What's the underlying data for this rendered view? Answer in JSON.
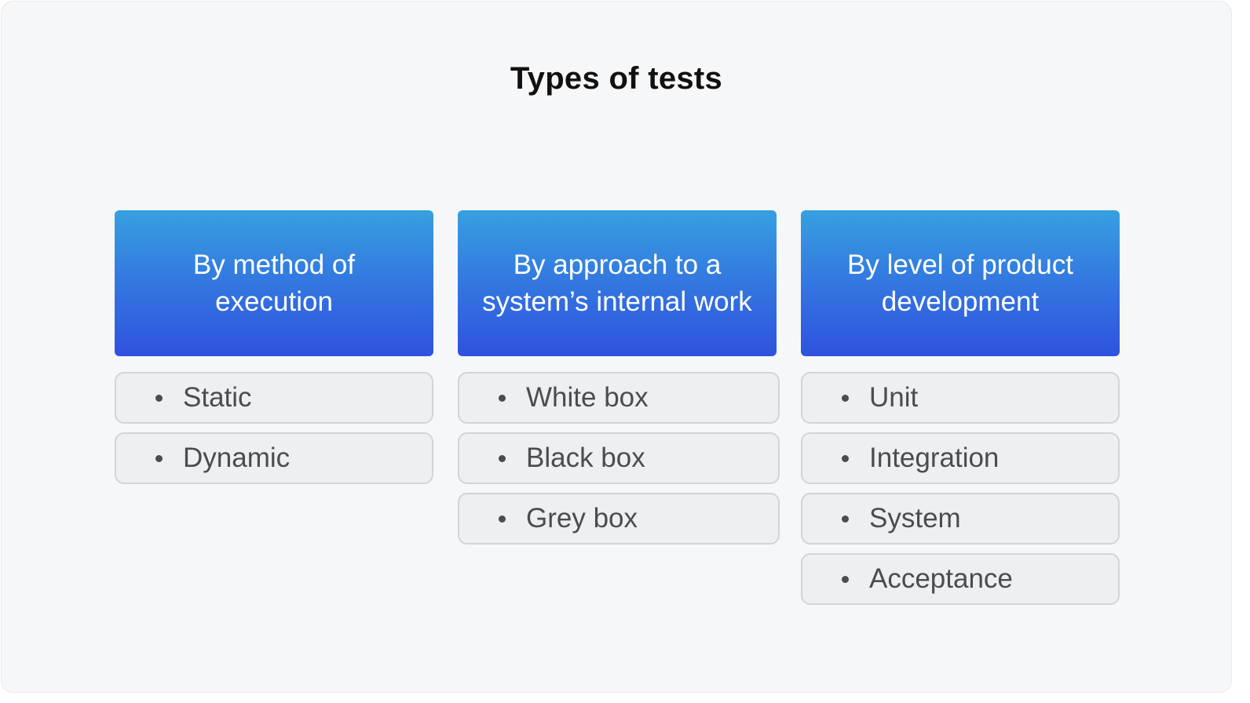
{
  "title": "Types of tests",
  "columns": [
    {
      "header": "By method of execution",
      "items": [
        "Static",
        "Dynamic"
      ]
    },
    {
      "header": "By approach to a system’s internal work",
      "items": [
        "White box",
        "Black box",
        "Grey box"
      ]
    },
    {
      "header": "By level of product development",
      "items": [
        "Unit",
        "Integration",
        "System",
        "Acceptance"
      ]
    }
  ],
  "colors": {
    "header_gradient_top": "#37a0e0",
    "header_gradient_bottom": "#2f52df",
    "item_background": "#eeeff1",
    "item_border": "#d3d4d7",
    "text_dark": "#4a4c50"
  }
}
